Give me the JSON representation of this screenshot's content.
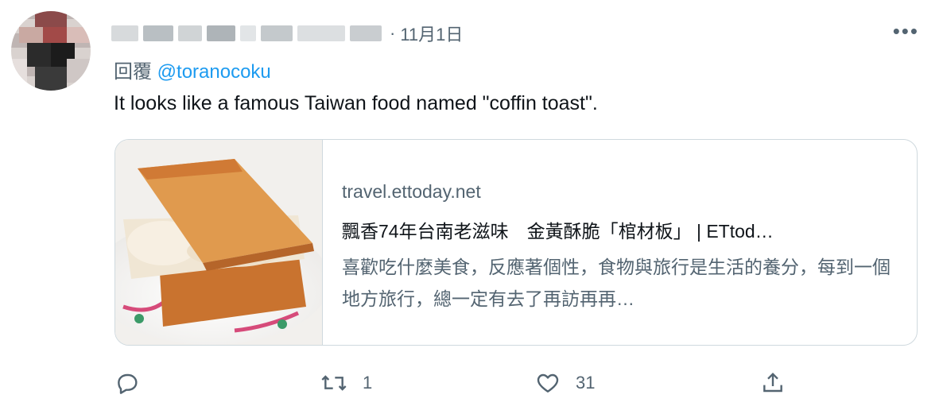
{
  "tweet": {
    "date": "11月1日",
    "separator": "·",
    "more_label": "•••",
    "reply_prefix": "回覆",
    "reply_to": "@toranocoku",
    "text": "It looks like a famous Taiwan food named \"coffin toast\"."
  },
  "card": {
    "domain": "travel.ettoday.net",
    "title": "飄香74年台南老滋味　金黃酥脆「棺材板」 | ETtod…",
    "description": "喜歡吃什麼美食，反應著個性，食物與旅行是生活的養分，每到一個地方旅行，總一定有去了再訪再再…"
  },
  "actions": {
    "reply_count": "",
    "retweet_count": "1",
    "like_count": "31"
  },
  "colors": {
    "accent": "#1d9bf0",
    "secondary_text": "#536471",
    "border": "#cfd9de"
  },
  "icons": [
    "reply-icon",
    "retweet-icon",
    "like-icon",
    "share-icon",
    "more-icon"
  ]
}
